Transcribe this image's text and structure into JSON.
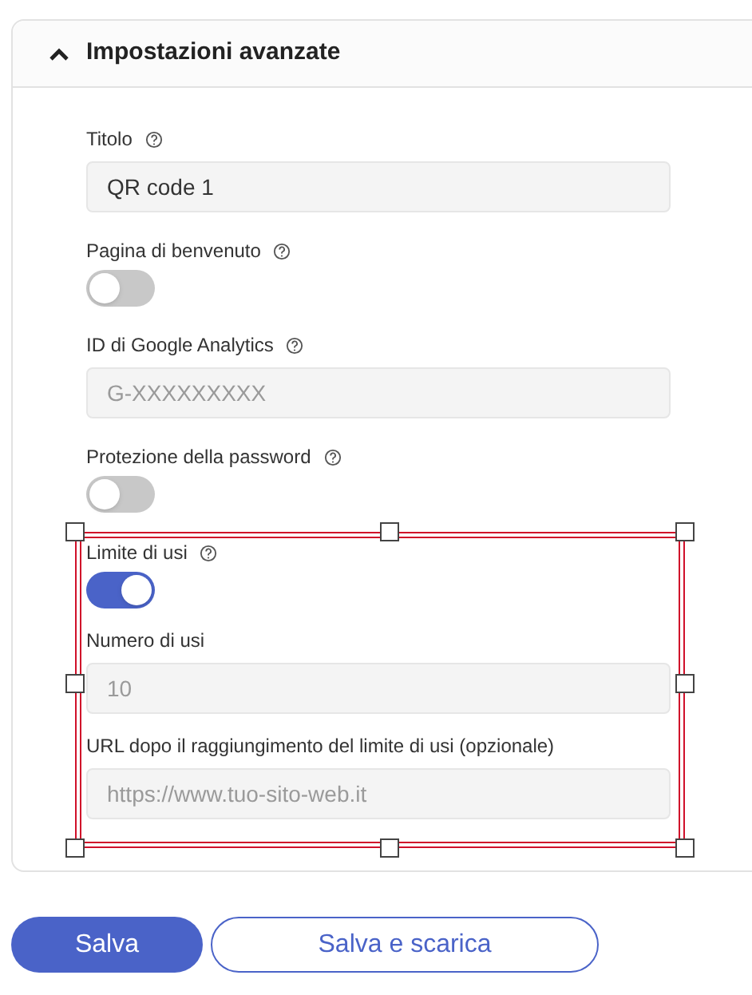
{
  "panel": {
    "title": "Impostazioni avanzate",
    "expanded": true
  },
  "fields": [
    {
      "kind": "input",
      "label": "Titolo",
      "help": true,
      "value": "QR code 1"
    },
    {
      "kind": "toggle",
      "label": "Pagina di benvenuto",
      "help": true,
      "on": false
    },
    {
      "kind": "input",
      "label": "ID di Google Analytics",
      "help": true,
      "placeholder": "G-XXXXXXXXX"
    },
    {
      "kind": "toggle",
      "label": "Protezione della password",
      "help": true,
      "on": false
    }
  ],
  "selection": {
    "fields": [
      {
        "kind": "toggle",
        "label": "Limite di usi",
        "help": true,
        "on": true
      },
      {
        "kind": "input",
        "label": "Numero di usi",
        "help": false,
        "placeholder": "10"
      },
      {
        "kind": "input",
        "label": "URL dopo il raggiungimento del limite di usi (opzionale)",
        "help": false,
        "placeholder": "https://www.tuo-sito-web.it"
      }
    ]
  },
  "buttons": [
    {
      "label": "Salva",
      "kind": "primary"
    },
    {
      "label": "Salva e scarica",
      "kind": "secondary"
    }
  ]
}
